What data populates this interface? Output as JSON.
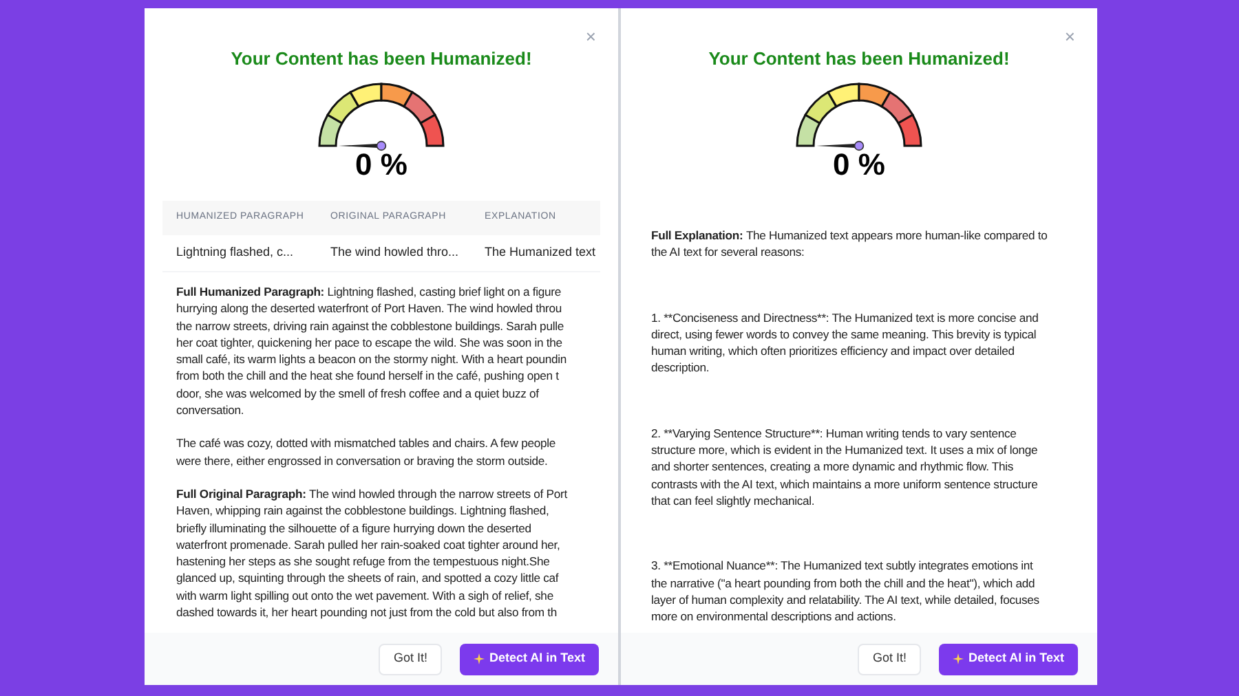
{
  "panels": [
    {
      "kind": "comparison",
      "close": "×",
      "title": "Your Content has been Humanized!",
      "gauge": {
        "reading": "0 %"
      },
      "table": {
        "columns": [
          "HUMANIZED PARAGRAPH",
          "ORIGINAL PARAGRAPH",
          "EXPLANATION"
        ],
        "rows": [
          [
            "Lightning flashed, c...",
            "The wind howled thro...",
            "The Humanized text"
          ]
        ]
      },
      "paragraphs": [
        {
          "label": "Full Humanized Paragraph:",
          "lines": [
            "Lightning flashed, casting brief light on a figure",
            "hurrying along the deserted waterfront of Port Haven. The wind howled throu",
            "the narrow streets, driving rain against the cobblestone buildings. Sarah pulle",
            "her coat tighter, quickening her pace to escape the wild. She was soon in the",
            "small café, its warm lights a beacon on the stormy night. With a heart poundin",
            "from both the chill and the heat she found herself in the café, pushing open t",
            "door, she was welcomed by the smell of fresh coffee and a quiet buzz of",
            "conversation."
          ]
        },
        {
          "lines": [
            "The café was cozy, dotted with mismatched tables and chairs. A few people",
            "were there, either engrossed in conversation or braving the storm outside."
          ]
        },
        {
          "label": "Full Original Paragraph:",
          "lines": [
            "The wind howled through the narrow streets of Port",
            "Haven, whipping rain against the cobblestone buildings. Lightning flashed,",
            "briefly illuminating the silhouette of a figure hurrying down the deserted",
            "waterfront promenade. Sarah pulled her rain-soaked coat tighter around her,",
            "hastening her steps as she sought refuge from the tempestuous night.She",
            "glanced up, squinting through the sheets of rain, and spotted a cozy little caf",
            "with warm light spilling out onto the wet pavement. With a sigh of relief, she",
            "dashed towards it, her heart pounding not just from the cold but also from th"
          ]
        }
      ],
      "buttons": [
        {
          "kind": "secondary",
          "label": "Got It!"
        },
        {
          "kind": "primary",
          "label": "Detect AI in Text"
        }
      ]
    },
    {
      "kind": "explanation",
      "close": "×",
      "title": "Your Content has been Humanized!",
      "gauge": {
        "reading": "0 %"
      },
      "paragraphs": [
        {
          "label": "Full Explanation:",
          "lines": [
            "The Humanized text appears more human-like compared to",
            "the AI text for several reasons:"
          ]
        },
        {
          "lines": [
            "1. **Conciseness and Directness**: The Humanized text is more concise and",
            "direct, using fewer words to convey the same meaning. This brevity is typical",
            "human writing, which often prioritizes efficiency and impact over detailed",
            "description."
          ]
        },
        {
          "lines": [
            "2. **Varying Sentence Structure**: Human writing tends to vary sentence",
            "structure more, which is evident in the Humanized text. It uses a mix of longe",
            "and shorter sentences, creating a more dynamic and rhythmic flow. This",
            "contrasts with the AI text, which maintains a more uniform sentence structure",
            "that can feel slightly mechanical."
          ]
        },
        {
          "lines": [
            "3. **Emotional Nuance**: The Humanized text subtly integrates emotions int",
            "the narrative (\"a heart pounding from both the chill and the heat\"), which add",
            "layer of human complexity and relatability. The AI text, while detailed, focuses",
            "more on environmental descriptions and actions."
          ]
        }
      ],
      "buttons": [
        {
          "kind": "secondary",
          "label": "Got It!"
        },
        {
          "kind": "primary",
          "label": "Detect AI in Text"
        }
      ]
    }
  ]
}
